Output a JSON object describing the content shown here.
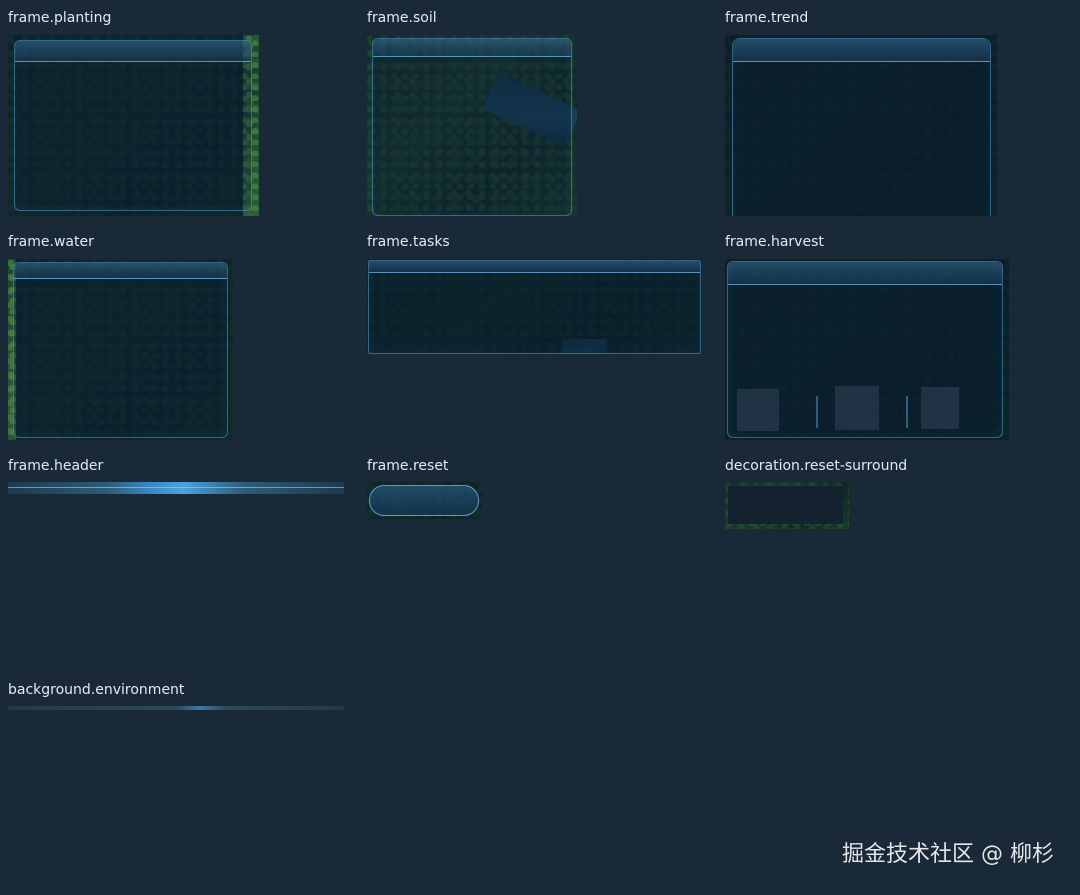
{
  "labels": {
    "planting": "frame.planting",
    "soil": "frame.soil",
    "trend": "frame.trend",
    "water": "frame.water",
    "tasks": "frame.tasks",
    "harvest": "frame.harvest",
    "header": "frame.header",
    "reset": "frame.reset",
    "reset_surround": "decoration.reset-surround",
    "environment": "background.environment"
  },
  "watermark": "掘金技术社区 @ 柳杉",
  "colors": {
    "background": "#192937",
    "label_text": "#e4e9ef",
    "frame_border": "#5aa0d2"
  }
}
